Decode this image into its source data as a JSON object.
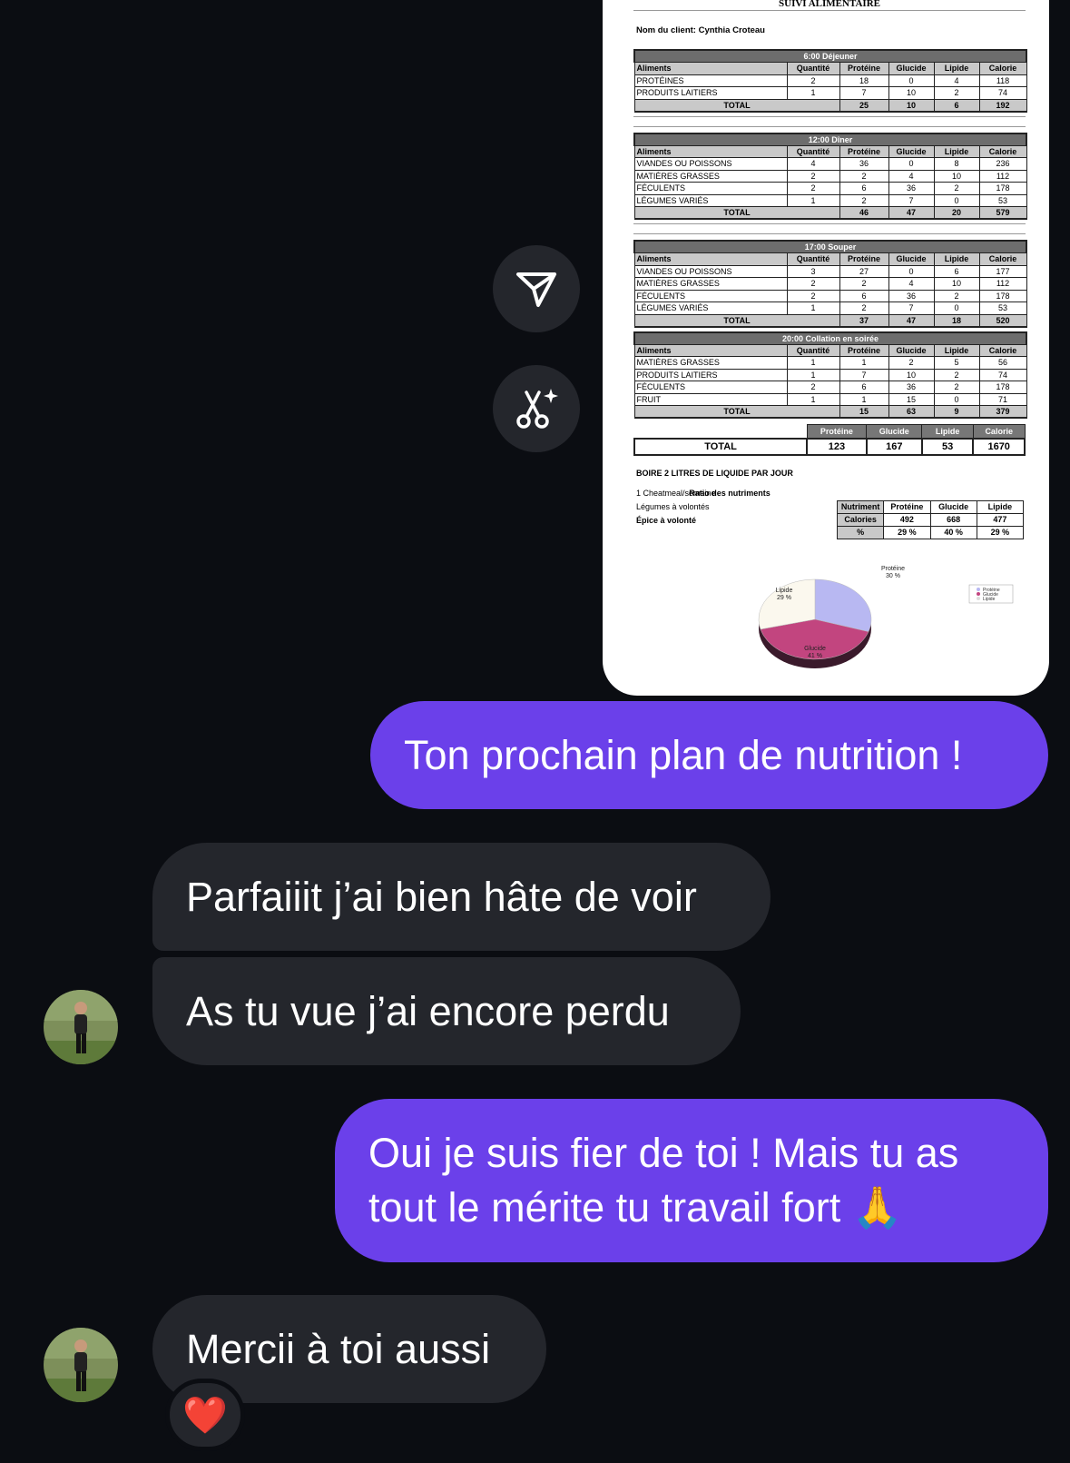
{
  "actions": {
    "share_icon": "paper-plane-icon",
    "edit_icon": "scissors-sparkle-icon"
  },
  "sheet": {
    "title": "SUIVI ALIMENTAIRE",
    "client": "Nom du client: Cynthia Croteau",
    "headers": [
      "Aliments",
      "Quantité",
      "Protéine",
      "Glucide",
      "Lipide",
      "Calorie"
    ],
    "total_label": "TOTAL",
    "meals": [
      {
        "title": "6:00 Déjeuner",
        "rows": [
          [
            "PROTÉINES",
            "2",
            "18",
            "0",
            "4",
            "118"
          ],
          [
            "PRODUITS LAITIERS",
            "1",
            "7",
            "10",
            "2",
            "74"
          ]
        ],
        "total": [
          "25",
          "10",
          "6",
          "192"
        ]
      },
      {
        "title": "12:00 Dîner",
        "rows": [
          [
            "VIANDES OU POISSONS",
            "4",
            "36",
            "0",
            "8",
            "236"
          ],
          [
            "MATIÈRES GRASSES",
            "2",
            "2",
            "4",
            "10",
            "112"
          ],
          [
            "FÉCULENTS",
            "2",
            "6",
            "36",
            "2",
            "178"
          ],
          [
            "LÉGUMES VARIÉS",
            "1",
            "2",
            "7",
            "0",
            "53"
          ]
        ],
        "total": [
          "46",
          "47",
          "20",
          "579"
        ]
      },
      {
        "title": "17:00 Souper",
        "rows": [
          [
            "VIANDES OU POISSONS",
            "3",
            "27",
            "0",
            "6",
            "177"
          ],
          [
            "MATIÈRES GRASSES",
            "2",
            "2",
            "4",
            "10",
            "112"
          ],
          [
            "FÉCULENTS",
            "2",
            "6",
            "36",
            "2",
            "178"
          ],
          [
            "LÉGUMES VARIÉS",
            "1",
            "2",
            "7",
            "0",
            "53"
          ]
        ],
        "total": [
          "37",
          "47",
          "18",
          "520"
        ]
      },
      {
        "title": "20:00 Collation en soirée",
        "rows": [
          [
            "MATIÈRES GRASSES",
            "1",
            "1",
            "2",
            "5",
            "56"
          ],
          [
            "PRODUITS LAITIERS",
            "1",
            "7",
            "10",
            "2",
            "74"
          ],
          [
            "FÉCULENTS",
            "2",
            "6",
            "36",
            "2",
            "178"
          ],
          [
            "FRUIT",
            "1",
            "1",
            "15",
            "0",
            "71"
          ]
        ],
        "total": [
          "15",
          "63",
          "9",
          "379"
        ]
      }
    ],
    "grand": {
      "label": "TOTAL",
      "headers": [
        "Protéine",
        "Glucide",
        "Lipide",
        "Calorie"
      ],
      "values": [
        "123",
        "167",
        "53",
        "1670"
      ]
    },
    "boire": "BOIRE 2 LITRES DE LIQUIDE PAR JOUR",
    "extras": [
      "1 Cheatmeal/semaine",
      "Légumes à volontés",
      "Épice à volonté"
    ],
    "ratio": {
      "title": "Ratio des nutriments",
      "headers": [
        "Nutriment",
        "Protéine",
        "Glucide",
        "Lipide"
      ],
      "calories": [
        "Calories",
        "492",
        "668",
        "477"
      ],
      "percent": [
        "%",
        "29 %",
        "40 %",
        "29 %"
      ]
    },
    "pie": {
      "slices": [
        {
          "label": "Protéine",
          "pct_text": "30 %",
          "value": 30,
          "color": "#b8b8f2"
        },
        {
          "label": "Glucide",
          "pct_text": "41 %",
          "value": 41,
          "color": "#c2457f"
        },
        {
          "label": "Lipide",
          "pct_text": "29 %",
          "value": 29,
          "color": "#fbf8ee"
        }
      ]
    }
  },
  "messages": [
    {
      "id": "m1",
      "from": "me",
      "text": "Ton prochain plan de nutrition !"
    },
    {
      "id": "m2",
      "from": "them",
      "text": "Parfaiiit j’ai bien hâte de voir"
    },
    {
      "id": "m3",
      "from": "them",
      "text": "As tu vue j’ai encore perdu"
    },
    {
      "id": "m4",
      "from": "me",
      "lines": [
        "Oui je suis fier de toi ! Mais tu as",
        "tout le mérite tu travail fort 🙏"
      ]
    },
    {
      "id": "m5",
      "from": "them",
      "text": "Mercii à toi aussi"
    }
  ],
  "reaction": "❤️",
  "colors": {
    "outgoing": "#6b40ea",
    "incoming": "#24262c",
    "background": "#0b0d12"
  }
}
